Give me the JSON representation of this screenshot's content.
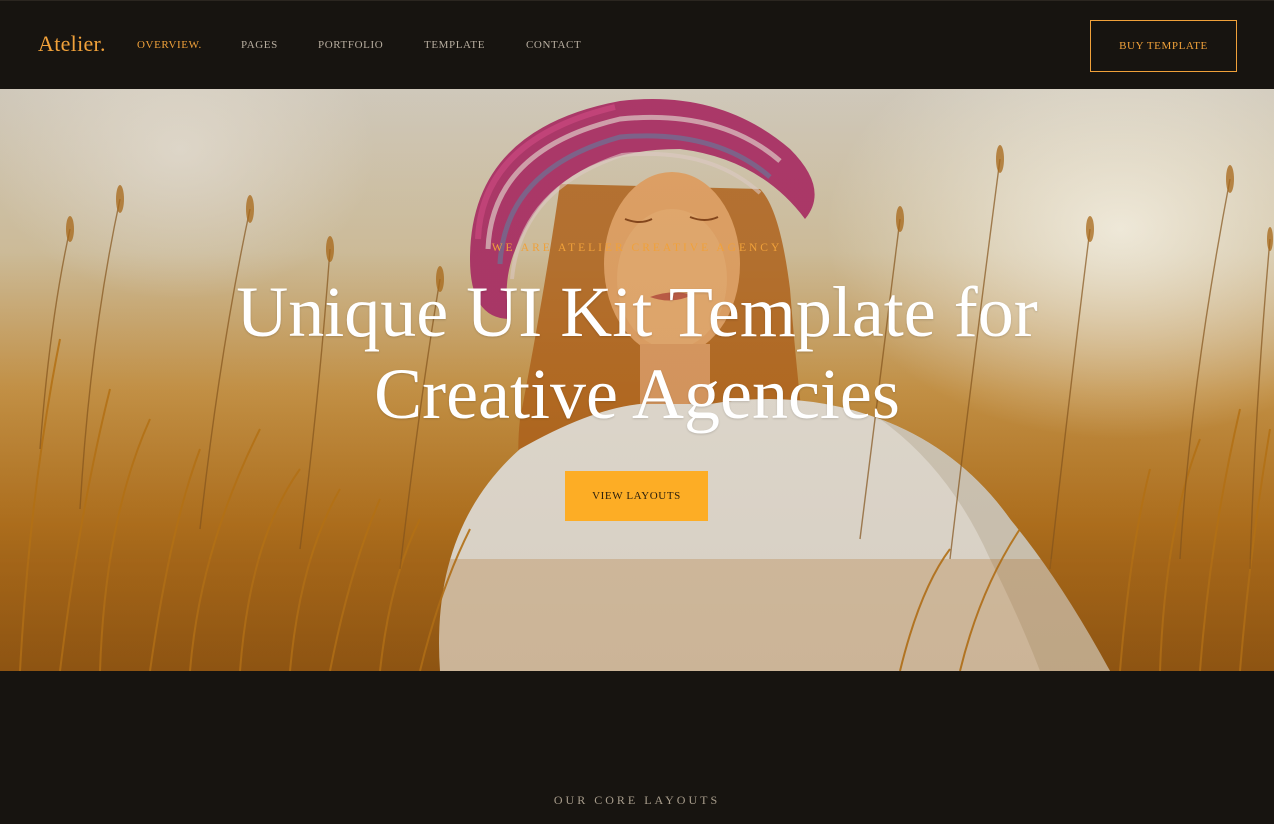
{
  "header": {
    "logo": "Atelier.",
    "nav": [
      {
        "label": "OVERVIEW.",
        "active": true
      },
      {
        "label": "PAGES",
        "active": false
      },
      {
        "label": "PORTFOLIO",
        "active": false
      },
      {
        "label": "TEMPLATE",
        "active": false
      },
      {
        "label": "CONTACT",
        "active": false
      }
    ],
    "buy_button": "BUY TEMPLATE"
  },
  "hero": {
    "eyebrow": "WE ARE ATELIER CREATIVE AGENCY",
    "headline_line1": "Unique UI Kit Template for",
    "headline_line2": "Creative Agencies",
    "cta": "VIEW LAYOUTS",
    "image": "photo-woman-in-wheat-field"
  },
  "section": {
    "label": "OUR CORE LAYOUTS"
  },
  "colors": {
    "accent": "#f0a13a",
    "button": "#fdad25",
    "background": "#171410"
  }
}
